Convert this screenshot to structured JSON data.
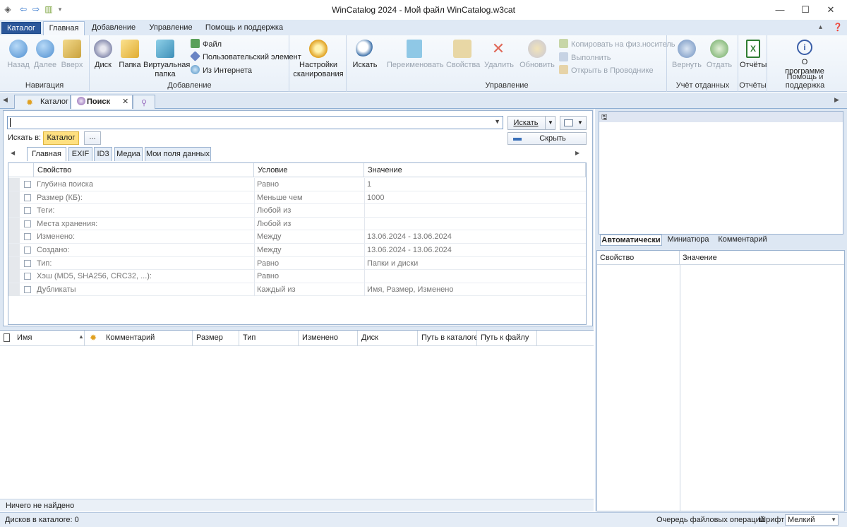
{
  "window": {
    "title": "WinCatalog 2024 - Мой файл WinCatalog.w3cat",
    "minimize": "—",
    "maximize": "☐",
    "close": "✕"
  },
  "ribbon_tabs": [
    "Каталог",
    "Главная",
    "Добавление",
    "Управление",
    "Помощь и поддержка"
  ],
  "groups": {
    "navigation": {
      "label": "Навигация",
      "back": "Назад",
      "forward": "Далее",
      "up": "Вверх"
    },
    "add": {
      "label": "Добавление",
      "disk": "Диск",
      "folder": "Папка",
      "virtual1": "Виртуальная",
      "virtual2": "папка",
      "file": "Файл",
      "custom": "Пользовательский элемент",
      "internet": "Из Интернета"
    },
    "scan": {
      "line1": "Настройки",
      "line2": "сканирования"
    },
    "manage": {
      "label": "Управление",
      "search": "Искать",
      "rename": "Переименовать",
      "properties": "Свойства",
      "delete": "Удалить",
      "refresh": "Обновить",
      "copy_phys": "Копировать на физ.носитель",
      "execute": "Выполнить",
      "open_explorer": "Открыть в Проводнике"
    },
    "lent": {
      "label": "Учёт отданных",
      "return": "Вернуть",
      "give": "Отдать"
    },
    "reports": {
      "label": "Отчёты",
      "btn": "Отчёты"
    },
    "help": {
      "label": "Помощь и поддержка",
      "about1": "О",
      "about2": "программе"
    }
  },
  "doc_tabs": {
    "catalog": "Каталог",
    "search": "Поиск",
    "close": "✕"
  },
  "search": {
    "query": "",
    "search_btn": "Искать",
    "hide_btn": "Скрыть",
    "search_in_label": "Искать в:",
    "scope": "Каталог",
    "more": "...",
    "subtabs": [
      "Главная",
      "EXIF",
      "ID3",
      "Медиа",
      "Мои поля данных"
    ]
  },
  "grid": {
    "headers": [
      "Свойство",
      "Условие",
      "Значение"
    ],
    "rows": [
      {
        "prop": "Глубина поиска",
        "cond": "Равно",
        "val": "1"
      },
      {
        "prop": "Размер (КБ):",
        "cond": "Меньше чем",
        "val": "1000"
      },
      {
        "prop": "Теги:",
        "cond": "Любой из",
        "val": ""
      },
      {
        "prop": "Места хранения:",
        "cond": "Любой из",
        "val": ""
      },
      {
        "prop": "Изменено:",
        "cond": "Между",
        "val": "13.06.2024 - 13.06.2024"
      },
      {
        "prop": "Создано:",
        "cond": "Между",
        "val": "13.06.2024 - 13.06.2024"
      },
      {
        "prop": "Тип:",
        "cond": "Равно",
        "val": "Папки и диски"
      },
      {
        "prop": "Хэш (MD5, SHA256, CRC32, ...):",
        "cond": "Равно",
        "val": ""
      },
      {
        "prop": "Дубликаты",
        "cond": "Каждый из",
        "val": "Имя, Размер, Изменено"
      }
    ]
  },
  "results": {
    "columns": [
      "Имя",
      "Комментарий",
      "Размер",
      "Тип",
      "Изменено",
      "Диск",
      "Путь в каталоге",
      "Путь к файлу"
    ],
    "status": "Ничего не найдено"
  },
  "preview_tabs": [
    "Автоматически",
    "Миниатюра",
    "Комментарий"
  ],
  "right_grid": {
    "headers": [
      "Свойство",
      "Значение"
    ]
  },
  "statusbar": {
    "disks": "Дисков в каталоге: 0",
    "queue": "Очередь файловых операций",
    "font_label": "Шрифт:",
    "font_value": "Мелкий"
  }
}
